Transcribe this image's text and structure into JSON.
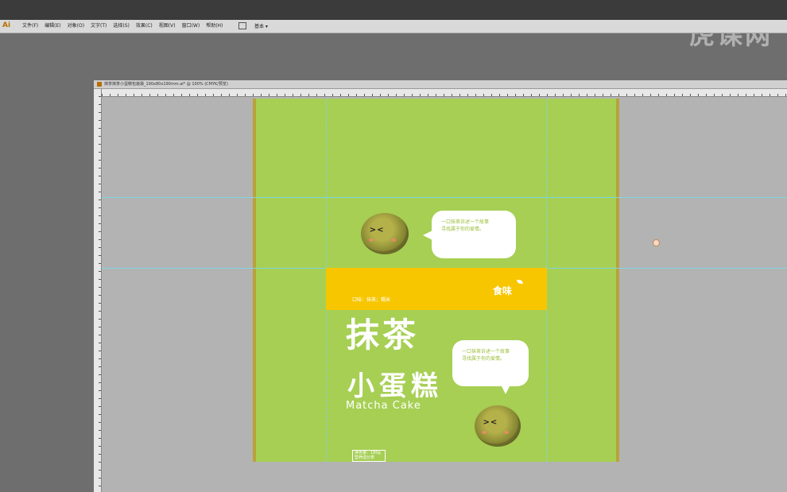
{
  "app": {
    "logo": "Ai"
  },
  "menus": [
    "文件(F)",
    "编辑(E)",
    "对象(O)",
    "文字(T)",
    "选择(S)",
    "效果(C)",
    "视图(V)",
    "窗口(W)",
    "帮助(H)"
  ],
  "toolbar": {
    "workspace": "基本"
  },
  "watermark": "虎课网",
  "document": {
    "title": "抹茶抹茶小蛋糕包装袋_190x80x190mm.ai* @ 100% (CMYK/预览)"
  },
  "design": {
    "bubble_top": "一口抹茶诉述一个故事\n寻找属于你的爱情。",
    "bubble_bottom": "一口抹茶诉述一个故事\n寻找属于你的爱情。",
    "band_text": "口味：抹茶；糯米",
    "brand_logo": "食味",
    "title_line1": "抹茶",
    "title_line2": "小蛋糕",
    "title_en": "Matcha Cake",
    "net_label_1": "净含量：180g",
    "net_label_2": "营养成分表"
  },
  "colors": {
    "artboard": "#a6cf54",
    "band": "#f7c600",
    "guide": "#7ed6e0"
  },
  "icons": [
    "ai-logo-icon",
    "cake-character-icon",
    "speech-bubble-icon",
    "leaf-icon"
  ]
}
